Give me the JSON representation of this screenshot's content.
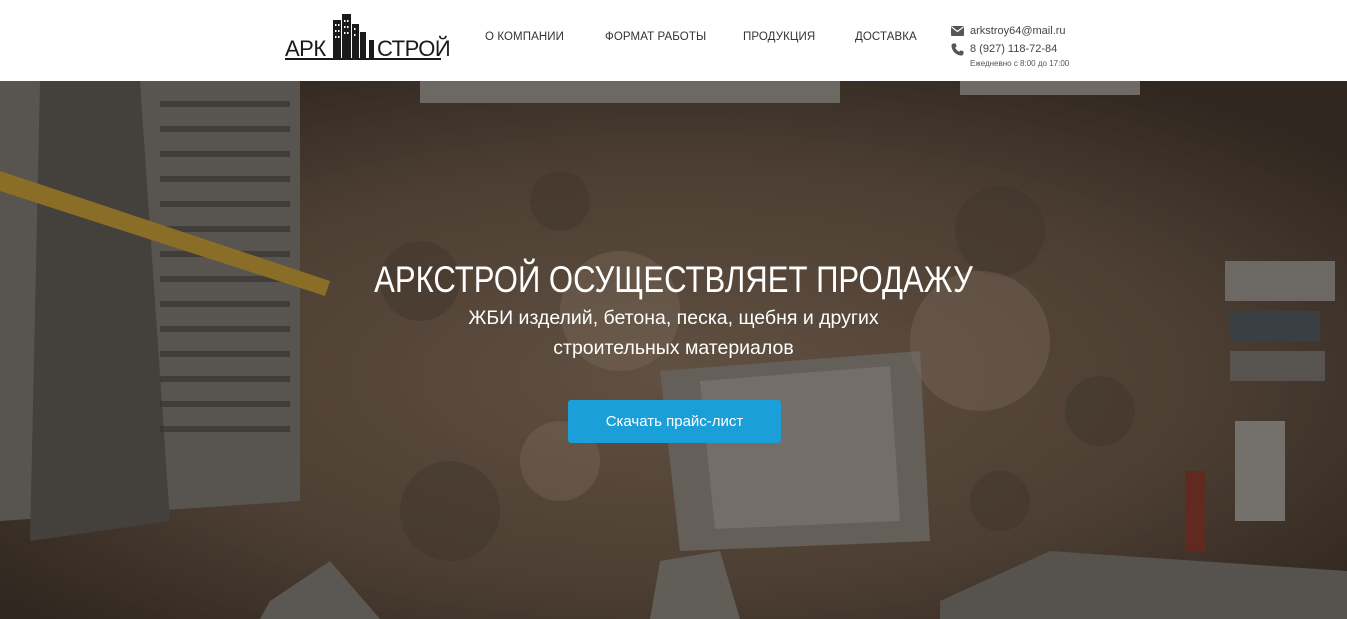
{
  "logo": {
    "left": "АРК",
    "right": "СТРОЙ"
  },
  "nav": [
    {
      "label": "О компании"
    },
    {
      "label": "Формат работы"
    },
    {
      "label": "Продукция"
    },
    {
      "label": "Доставка"
    }
  ],
  "contacts": {
    "email": "arkstroy64@mail.ru",
    "phone": "8 (927) 118-72-84",
    "schedule": "Ежедневно с 8:00 до 17:00",
    "email_icon": "envelope-icon",
    "phone_icon": "phone-icon"
  },
  "hero": {
    "title": "АРКСТРОЙ ОСУЩЕСТВЛЯЕТ ПРОДАЖУ",
    "subtitle_line1": "ЖБИ изделий, бетона, песка, щебня и других",
    "subtitle_line2": "строительных материалов",
    "cta_label": "Скачать прайс-лист"
  },
  "colors": {
    "accent": "#1a9fd9",
    "header_bg": "#ffffff",
    "text_dark": "#333333"
  }
}
